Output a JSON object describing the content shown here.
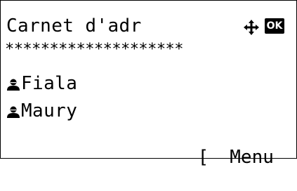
{
  "screen": {
    "title": "Carnet d'adr",
    "separator": "********************",
    "icons": {
      "navigation": "four-way-arrow-icon",
      "confirm": "ok-key-icon",
      "entry": "person-icon"
    },
    "ok_label": "OK"
  },
  "entries": [
    {
      "label": "Fiala"
    },
    {
      "label": "Maury"
    }
  ],
  "softkey": {
    "open": "[",
    "label": "Menu",
    "close": "]"
  }
}
